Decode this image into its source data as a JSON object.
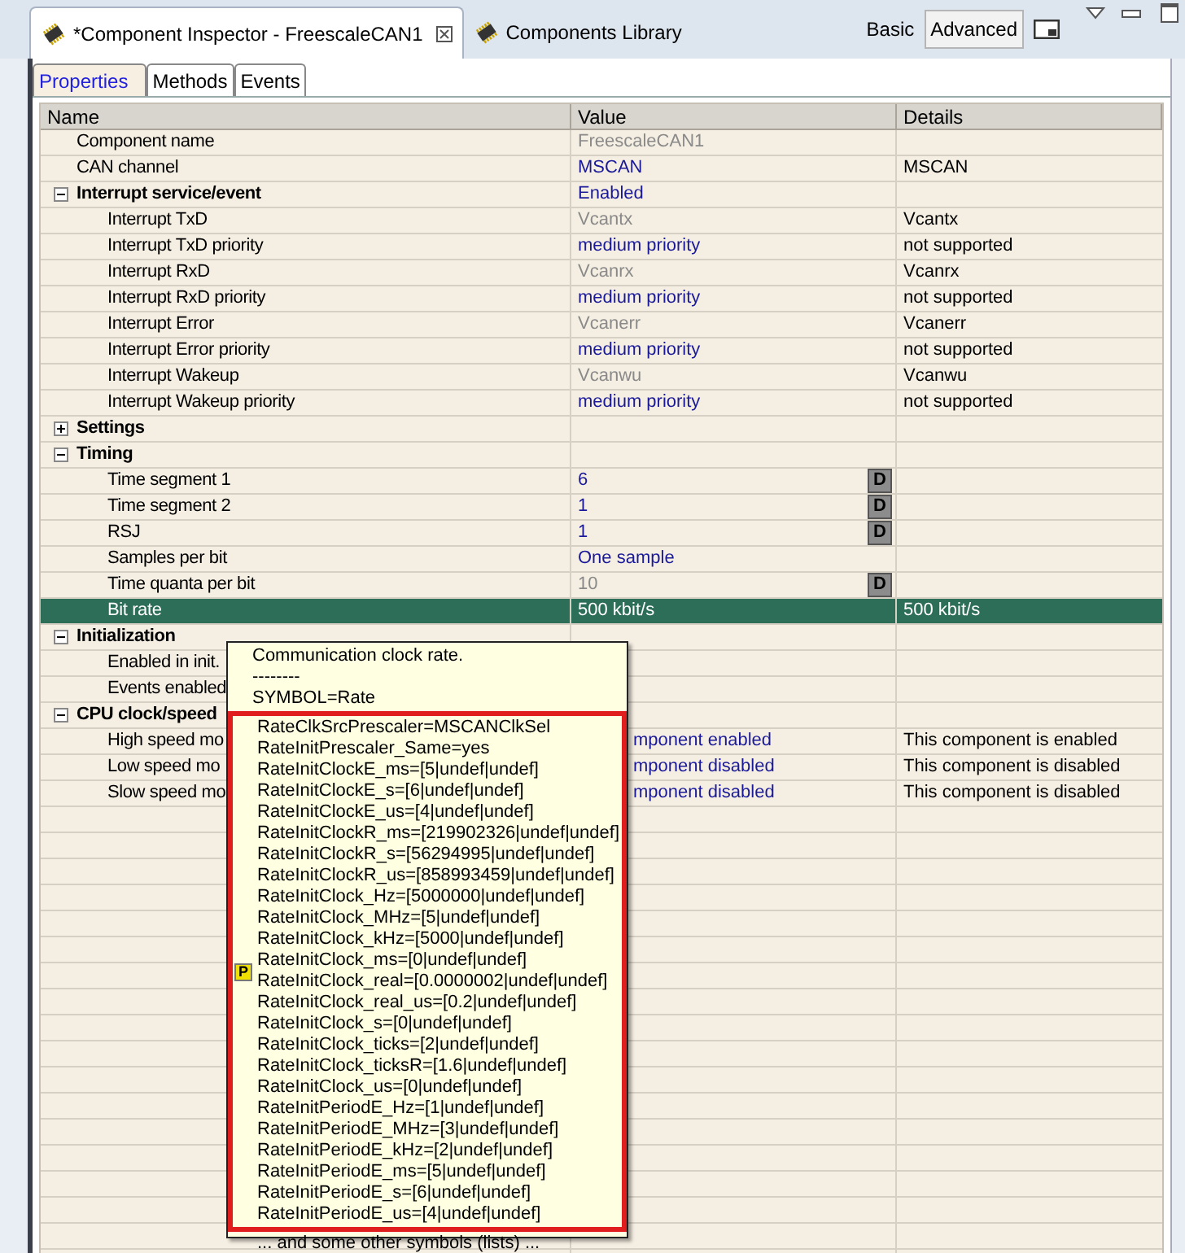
{
  "editor_tabs": [
    {
      "label": "*Component Inspector - FreescaleCAN1",
      "selected": true,
      "closable": true
    },
    {
      "label": "Components Library",
      "selected": false,
      "closable": false
    }
  ],
  "mode_buttons": [
    {
      "label": "Basic",
      "selected": false
    },
    {
      "label": "Advanced",
      "selected": true
    }
  ],
  "sub_tabs": [
    {
      "label": "Properties",
      "selected": true
    },
    {
      "label": "Methods",
      "selected": false
    },
    {
      "label": "Events",
      "selected": false
    }
  ],
  "table": {
    "columns": [
      "Name",
      "Value",
      "Details"
    ],
    "rows": [
      {
        "kind": "property",
        "name": "Component name",
        "value": "FreescaleCAN1",
        "readonly": true,
        "selected": false
      },
      {
        "kind": "property",
        "name": "CAN channel",
        "value": "MSCAN",
        "readonly": false,
        "details": "MSCAN",
        "selected": false
      },
      {
        "kind": "group",
        "name": "Interrupt service/event",
        "value": "Enabled",
        "expanded": true,
        "selected": false,
        "children": [
          {
            "kind": "property",
            "name": "Interrupt TxD",
            "value": "Vcantx",
            "readonly": true,
            "details": "Vcantx",
            "selected": false
          },
          {
            "kind": "property",
            "name": "Interrupt TxD priority",
            "value": "medium priority",
            "readonly": false,
            "details": "not supported",
            "selected": false
          },
          {
            "kind": "property",
            "name": "Interrupt RxD",
            "value": "Vcanrx",
            "readonly": true,
            "details": "Vcanrx",
            "selected": false
          },
          {
            "kind": "property",
            "name": "Interrupt RxD priority",
            "value": "medium priority",
            "readonly": false,
            "details": "not supported",
            "selected": false
          },
          {
            "kind": "property",
            "name": "Interrupt Error",
            "value": "Vcanerr",
            "readonly": true,
            "details": "Vcanerr",
            "selected": false
          },
          {
            "kind": "property",
            "name": "Interrupt Error priority",
            "value": "medium priority",
            "readonly": false,
            "details": "not supported",
            "selected": false
          },
          {
            "kind": "property",
            "name": "Interrupt Wakeup",
            "value": "Vcanwu",
            "readonly": true,
            "details": "Vcanwu",
            "selected": false
          },
          {
            "kind": "property",
            "name": "Interrupt Wakeup priority",
            "value": "medium priority",
            "readonly": false,
            "details": "not supported",
            "selected": false
          }
        ]
      },
      {
        "kind": "group",
        "name": "Settings",
        "expanded": false,
        "selected": false
      },
      {
        "kind": "group",
        "name": "Timing",
        "expanded": true,
        "selected": false,
        "children": [
          {
            "kind": "property",
            "name": "Time segment 1",
            "value": "6",
            "readonly": false,
            "button": "D",
            "selected": false
          },
          {
            "kind": "property",
            "name": "Time segment 2",
            "value": "1",
            "readonly": false,
            "button": "D",
            "selected": false
          },
          {
            "kind": "property",
            "name": "RSJ",
            "value": "1",
            "readonly": false,
            "button": "D",
            "selected": false
          },
          {
            "kind": "property",
            "name": "Samples per bit",
            "value": "One sample",
            "readonly": false,
            "selected": false
          },
          {
            "kind": "property",
            "name": "Time quanta per bit",
            "value": "10",
            "readonly": true,
            "button": "D",
            "selected": false
          },
          {
            "kind": "property",
            "name": "Bit rate",
            "value": "500 kbit/s",
            "readonly": false,
            "details": "500 kbit/s",
            "selected": true
          }
        ]
      },
      {
        "kind": "group",
        "name": "Initialization",
        "expanded": true,
        "selected": false,
        "children": [
          {
            "kind": "property",
            "name": "Enabled in init.",
            "selected": false
          },
          {
            "kind": "property",
            "name": "Events enabled",
            "selected": false
          }
        ]
      },
      {
        "kind": "group",
        "name": "CPU clock/speed",
        "expanded": true,
        "selected": false,
        "children": [
          {
            "kind": "property",
            "name": "High speed mo",
            "value": "mponent enabled",
            "covered": true,
            "readonly": false,
            "details": "This component is enabled",
            "selected": false
          },
          {
            "kind": "property",
            "name": "Low speed mo",
            "value": "mponent disabled",
            "covered": true,
            "readonly": false,
            "details": "This component is disabled",
            "selected": false
          },
          {
            "kind": "property",
            "name": "Slow speed mo",
            "value": "mponent disabled",
            "covered": true,
            "readonly": false,
            "details": "This component is disabled",
            "selected": false
          }
        ]
      }
    ]
  },
  "tooltip": {
    "description": "Communication clock rate.",
    "separator": "--------",
    "symbol": "SYMBOL=Rate",
    "marker": "P",
    "symbols": [
      "RateClkSrcPrescaler=MSCANClkSel",
      "RateInitPrescaler_Same=yes",
      "RateInitClockE_ms=[5|undef|undef]",
      "RateInitClockE_s=[6|undef|undef]",
      "RateInitClockE_us=[4|undef|undef]",
      "RateInitClockR_ms=[219902326|undef|undef]",
      "RateInitClockR_s=[56294995|undef|undef]",
      "RateInitClockR_us=[858993459|undef|undef]",
      "RateInitClock_Hz=[5000000|undef|undef]",
      "RateInitClock_MHz=[5|undef|undef]",
      "RateInitClock_kHz=[5000|undef|undef]",
      "RateInitClock_ms=[0|undef|undef]",
      "RateInitClock_real=[0.0000002|undef|undef]",
      "RateInitClock_real_us=[0.2|undef|undef]",
      "RateInitClock_s=[0|undef|undef]",
      "RateInitClock_ticks=[2|undef|undef]",
      "RateInitClock_ticksR=[1.6|undef|undef]",
      "RateInitClock_us=[0|undef|undef]",
      "RateInitPeriodE_Hz=[1|undef|undef]",
      "RateInitPeriodE_MHz=[3|undef|undef]",
      "RateInitPeriodE_kHz=[2|undef|undef]",
      "RateInitPeriodE_ms=[5|undef|undef]",
      "RateInitPeriodE_s=[6|undef|undef]",
      "RateInitPeriodE_us=[4|undef|undef]"
    ],
    "footer": "... and some other symbols (lists) ..."
  }
}
